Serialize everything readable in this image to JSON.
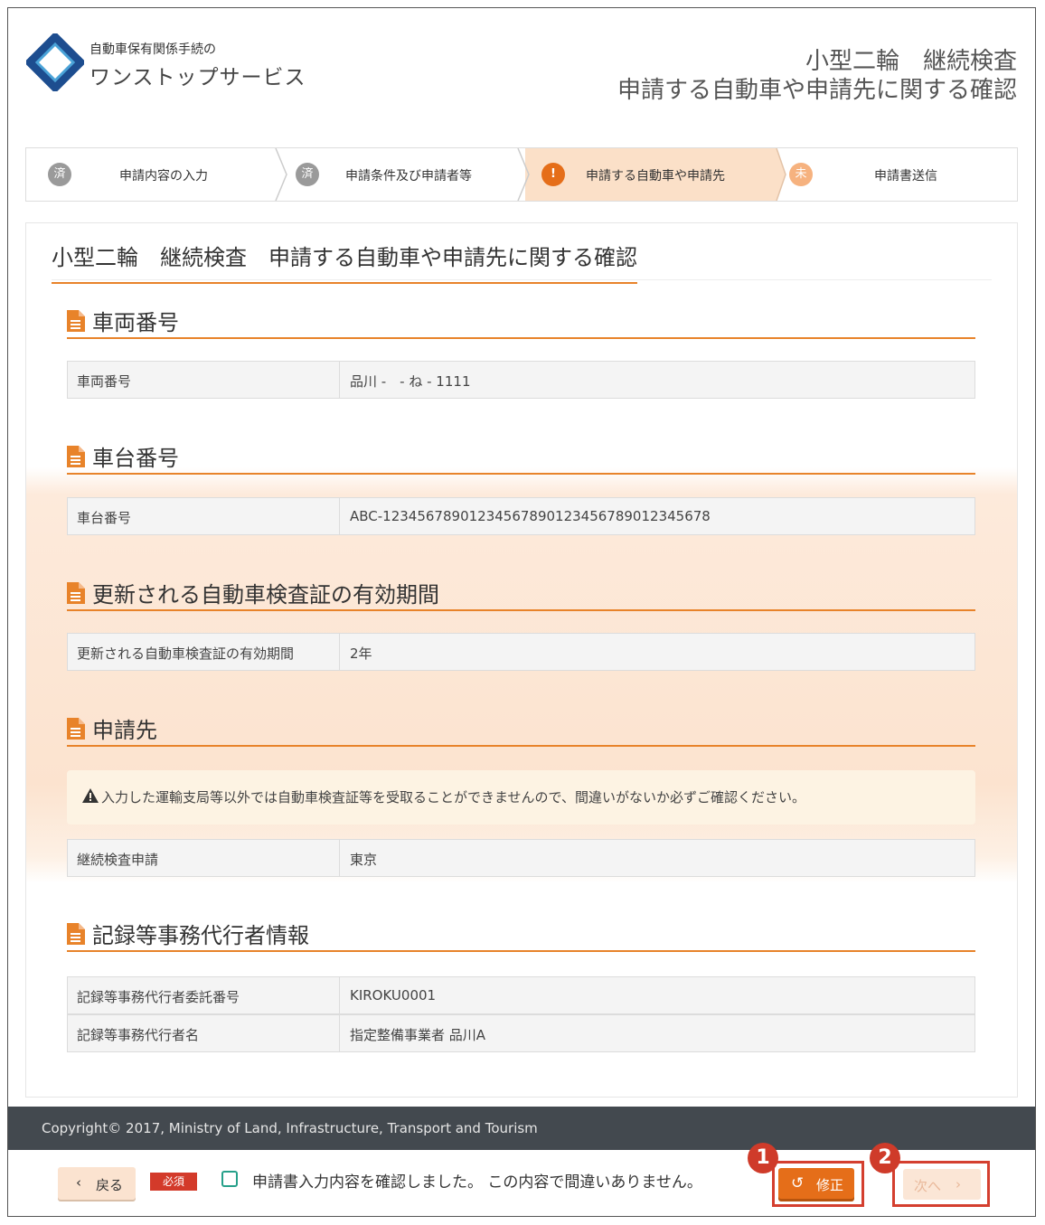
{
  "header": {
    "logo_small": "自動車保有関係手続の",
    "logo_big": "ワンストップサービス",
    "title_line1": "小型二輪　継続検査",
    "title_line2": "申請する自動車や申請先に関する確認"
  },
  "steps": [
    {
      "icon": "済",
      "label": "申請内容の入力",
      "state": "done"
    },
    {
      "icon": "済",
      "label": "申請条件及び申請者等",
      "state": "done"
    },
    {
      "icon": "!",
      "label": "申請する自動車や申請先",
      "state": "active"
    },
    {
      "icon": "未",
      "label": "申請書送信",
      "state": "pending"
    }
  ],
  "page_title": "小型二輪　継続検査　申請する自動車や申請先に関する確認",
  "sections": {
    "vehicle_number": {
      "heading": "車両番号",
      "rows": [
        {
          "key": "車両番号",
          "value": "品川 -　- ね - 1111"
        }
      ]
    },
    "chassis_number": {
      "heading": "車台番号",
      "rows": [
        {
          "key": "車台番号",
          "value": "ABC-1234567890123456789012345678901234567​8"
        }
      ]
    },
    "validity": {
      "heading": "更新される自動車検査証の有効期間",
      "rows": [
        {
          "key": "更新される自動車検査証の有効期間",
          "value": "2年"
        }
      ]
    },
    "destination": {
      "heading": "申請先",
      "warning": "入力した運輸支局等以外では自動車検査証等を受取ることができませんので、間違いがないか必ずご確認ください。",
      "rows": [
        {
          "key": "継続検査申請",
          "value": "東京"
        }
      ]
    },
    "agent": {
      "heading": "記録等事務代行者情報",
      "rows": [
        {
          "key": "記録等事務代行者委託番号",
          "value": "KIROKU0001"
        },
        {
          "key": "記録等事務代行者名",
          "value": "指定整備事業者 品川A"
        }
      ]
    }
  },
  "footer": {
    "copyright": "Copyright© 2017, Ministry of Land, Infrastructure, Transport and Tourism",
    "back_label": "戻る",
    "required_label": "必須",
    "confirm_text": "申請書入力内容を確認しました。 この内容で間違いありません。",
    "fix_label": "修正",
    "next_label": "次へ",
    "badge_1": "1",
    "badge_2": "2"
  },
  "colors": {
    "accent": "#e8832a",
    "button_primary": "#e56e19",
    "highlight": "#d43f2f",
    "footer_bg": "#43494f"
  }
}
